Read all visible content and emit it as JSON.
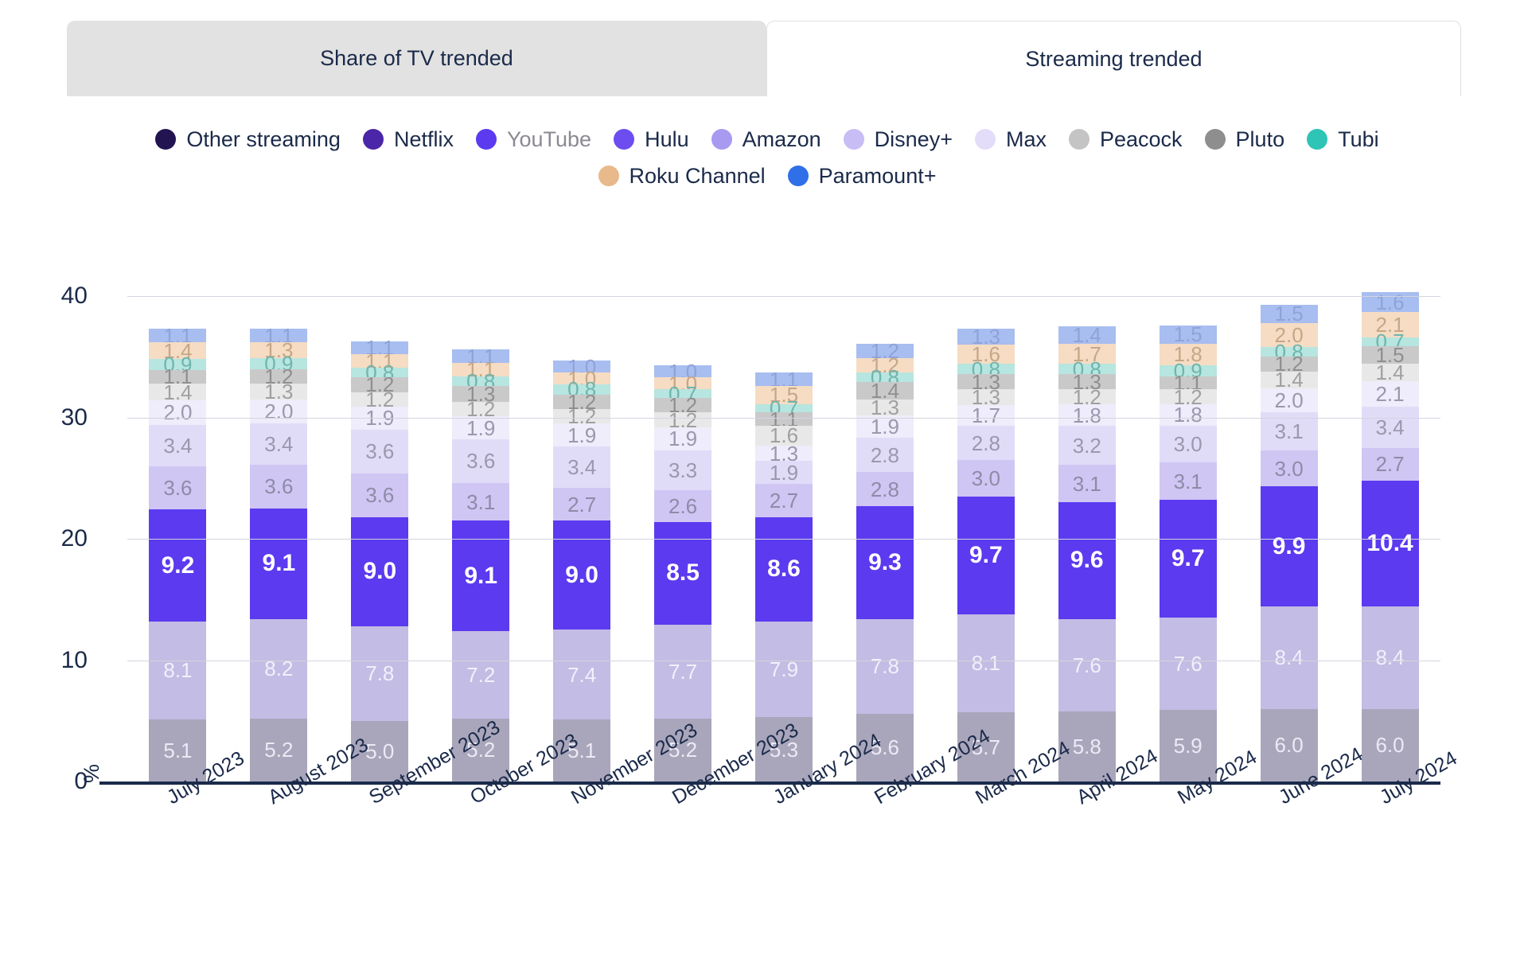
{
  "tabs": [
    {
      "label": "Share of TV trended",
      "active": false
    },
    {
      "label": "Streaming trended",
      "active": true
    }
  ],
  "legend": {
    "row1": [
      {
        "label": "Other streaming",
        "color": "#221450",
        "muted": false
      },
      {
        "label": "Netflix",
        "color": "#4b26a8",
        "muted": false
      },
      {
        "label": "YouTube",
        "color": "#5b3af0",
        "muted": true
      },
      {
        "label": "Hulu",
        "color": "#6d4cf0",
        "muted": false
      },
      {
        "label": "Amazon",
        "color": "#a89af0",
        "muted": false
      },
      {
        "label": "Disney+",
        "color": "#c8bdf4",
        "muted": false
      },
      {
        "label": "Max",
        "color": "#e3ddf9",
        "muted": false
      },
      {
        "label": "Peacock",
        "color": "#c4c4c4",
        "muted": false
      },
      {
        "label": "Pluto",
        "color": "#8e8e8e",
        "muted": false
      },
      {
        "label": "Tubi",
        "color": "#2ec4b6",
        "muted": false
      }
    ],
    "row2": [
      {
        "label": "Roku Channel",
        "color": "#e8b98a",
        "muted": false
      },
      {
        "label": "Paramount+",
        "color": "#2f6fe8",
        "muted": false
      }
    ]
  },
  "chart_data": {
    "type": "bar",
    "subtype": "stacked",
    "title": "",
    "xlabel": "",
    "ylabel": "%",
    "ylim": [
      0,
      40
    ],
    "yticks": [
      "0",
      "10",
      "20",
      "30",
      "40"
    ],
    "grid": true,
    "legend_position": "top",
    "categories": [
      "July 2023",
      "August 2023",
      "September 2023",
      "October 2023",
      "November 2023",
      "December 2023",
      "January 2024",
      "February 2024",
      "March 2024",
      "April 2024",
      "May 2024",
      "June 2024",
      "July 2024"
    ],
    "series": [
      {
        "name": "Other streaming",
        "color": "#a9a6bb",
        "label_color": "#eceaf5",
        "values": [
          5.1,
          5.2,
          5.0,
          5.2,
          5.1,
          5.2,
          5.3,
          5.6,
          5.7,
          5.8,
          5.9,
          6.0,
          6.0
        ]
      },
      {
        "name": "Netflix",
        "color": "#c3bce4",
        "label_color": "#f2f0fb",
        "values": [
          8.1,
          8.2,
          7.8,
          7.2,
          7.4,
          7.7,
          7.9,
          7.8,
          8.1,
          7.6,
          7.6,
          8.4,
          8.4
        ]
      },
      {
        "name": "YouTube",
        "color": "#5b3af0",
        "label_color": "#ffffff",
        "values": [
          9.2,
          9.1,
          9.0,
          9.1,
          9.0,
          8.5,
          8.6,
          9.3,
          9.7,
          9.6,
          9.7,
          9.9,
          10.4
        ]
      },
      {
        "name": "Amazon",
        "color": "#cfc6f4",
        "label_color": "#8e8ba6",
        "values": [
          3.6,
          3.6,
          3.6,
          3.1,
          2.7,
          2.6,
          2.7,
          2.8,
          3.0,
          3.1,
          3.1,
          3.0,
          2.7
        ]
      },
      {
        "name": "Disney+",
        "color": "#e0dcf8",
        "label_color": "#9b97ad",
        "values": [
          3.4,
          3.4,
          3.6,
          3.6,
          3.4,
          3.3,
          1.9,
          2.8,
          2.8,
          3.2,
          3.0,
          3.1,
          3.4
        ]
      },
      {
        "name": "Max",
        "color": "#efecfb",
        "label_color": "#9b97ad",
        "values": [
          2.0,
          2.0,
          1.9,
          1.9,
          1.9,
          1.9,
          1.3,
          1.9,
          1.7,
          1.8,
          1.8,
          2.0,
          2.1
        ]
      },
      {
        "name": "Peacock",
        "color": "#e8e8e8",
        "label_color": "#a0a0a0",
        "values": [
          1.4,
          1.3,
          1.2,
          1.2,
          1.2,
          1.2,
          1.6,
          1.3,
          1.3,
          1.2,
          1.2,
          1.4,
          1.4
        ]
      },
      {
        "name": "Pluto",
        "color": "#c9c9c9",
        "label_color": "#8f8f8f",
        "values": [
          1.1,
          1.2,
          1.2,
          1.3,
          1.2,
          1.2,
          1.1,
          1.4,
          1.3,
          1.3,
          1.1,
          1.2,
          1.5
        ]
      },
      {
        "name": "Tubi",
        "color": "#b7e5e0",
        "label_color": "#6fb5ae",
        "values": [
          0.9,
          0.9,
          0.8,
          0.8,
          0.8,
          0.7,
          0.7,
          0.8,
          0.8,
          0.8,
          0.9,
          0.8,
          0.7
        ]
      },
      {
        "name": "Roku Channel",
        "color": "#f5dcc3",
        "label_color": "#c6a788",
        "values": [
          1.4,
          1.3,
          1.1,
          1.1,
          1.0,
          1.0,
          1.5,
          1.2,
          1.6,
          1.7,
          1.8,
          2.0,
          2.1
        ]
      },
      {
        "name": "Paramount+",
        "color": "#a8bdf0",
        "label_color": "#8fa3d8",
        "values": [
          1.1,
          1.1,
          1.1,
          1.1,
          1.0,
          1.0,
          1.1,
          1.2,
          1.3,
          1.4,
          1.5,
          1.5,
          1.6
        ]
      }
    ]
  }
}
